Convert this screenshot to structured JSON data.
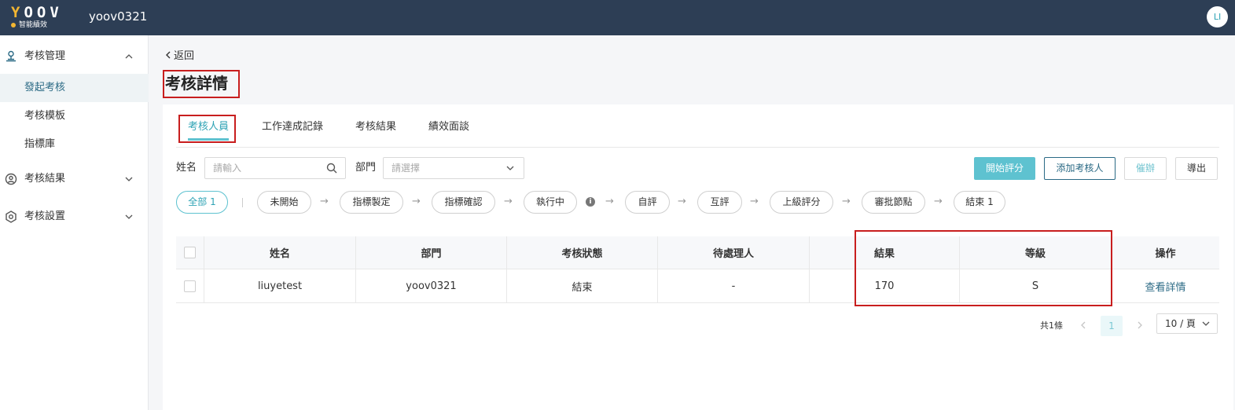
{
  "header": {
    "logo_letters": "YOOV",
    "logo_sub": "智能績效",
    "org_name": "yoov0321",
    "user_initials": "LI"
  },
  "sidebar": {
    "groups": [
      {
        "label": "考核管理",
        "icon": "user-stamp-icon",
        "expanded": true
      },
      {
        "label": "考核結果",
        "icon": "search-user-icon",
        "expanded": false
      },
      {
        "label": "考核設置",
        "icon": "settings-hex-icon",
        "expanded": false
      }
    ],
    "items": [
      {
        "label": "發起考核",
        "active": true
      },
      {
        "label": "考核模板",
        "active": false
      },
      {
        "label": "指標庫",
        "active": false
      }
    ]
  },
  "page": {
    "back_label": "返回",
    "title": "考核詳情"
  },
  "tabs": [
    {
      "label": "考核人員",
      "active": true
    },
    {
      "label": "工作達成記錄",
      "active": false
    },
    {
      "label": "考核結果",
      "active": false
    },
    {
      "label": "績效面談",
      "active": false
    }
  ],
  "filters": {
    "name_label": "姓名",
    "name_placeholder": "請輸入",
    "dept_label": "部門",
    "dept_placeholder": "請選擇"
  },
  "actions": {
    "start_review": "開始評分",
    "add_reviewee": "添加考核人",
    "remind": "催辦",
    "export": "導出"
  },
  "stages": [
    {
      "label": "全部 1",
      "active": true
    },
    {
      "label": "未開始"
    },
    {
      "label": "指標製定"
    },
    {
      "label": "指標確認"
    },
    {
      "label": "執行中"
    },
    {
      "label": "自評"
    },
    {
      "label": "互評"
    },
    {
      "label": "上級評分"
    },
    {
      "label": "審批節點"
    },
    {
      "label": "結束 1"
    }
  ],
  "stage_arrow": "→",
  "info_glyph": "i",
  "table": {
    "columns": [
      "姓名",
      "部門",
      "考核狀態",
      "待處理人",
      "結果",
      "等級",
      "操作"
    ],
    "rows": [
      {
        "name": "liuyetest",
        "dept": "yoov0321",
        "status": "結束",
        "handler": "-",
        "result": "170",
        "grade": "S",
        "action": "查看詳情"
      }
    ]
  },
  "pagination": {
    "total": "共1條",
    "current": "1",
    "page_size": "10 / 頁"
  },
  "colors": {
    "topbar": "#2d3e55",
    "accent": "#5ec2d0",
    "primary_dark": "#2b6a85",
    "highlight_box": "#c81e1e"
  }
}
